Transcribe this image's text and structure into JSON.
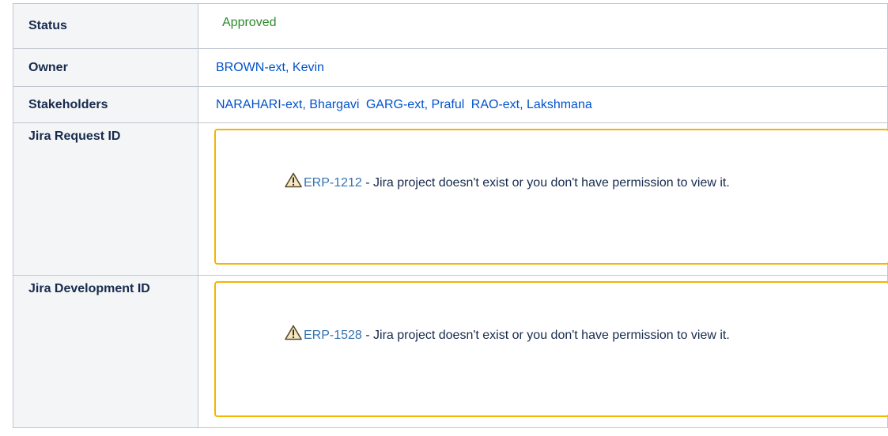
{
  "rows": {
    "status": {
      "label": "Status",
      "value": "Approved",
      "value_color": "#2b8a2b"
    },
    "owner": {
      "label": "Owner",
      "users": [
        "BROWN-ext, Kevin"
      ]
    },
    "stakeholders": {
      "label": "Stakeholders",
      "users": [
        "NARAHARI-ext, Bhargavi",
        "GARG-ext, Praful",
        "RAO-ext, Lakshmana"
      ]
    },
    "jira_request": {
      "label": "Jira Request ID",
      "issue_key": "ERP-1212",
      "message": " - Jira project doesn't exist or you don't have permission to view it.",
      "icon": "warning-icon"
    },
    "jira_development": {
      "label": "Jira Development ID",
      "issue_key": "ERP-1528",
      "message": " - Jira project doesn't exist or you don't have permission to view it.",
      "icon": "warning-icon"
    }
  },
  "colors": {
    "link": "#0052cc",
    "jira_link": "#3572b0",
    "warning_border": "#f5b400",
    "key_background": "#f4f5f7"
  }
}
